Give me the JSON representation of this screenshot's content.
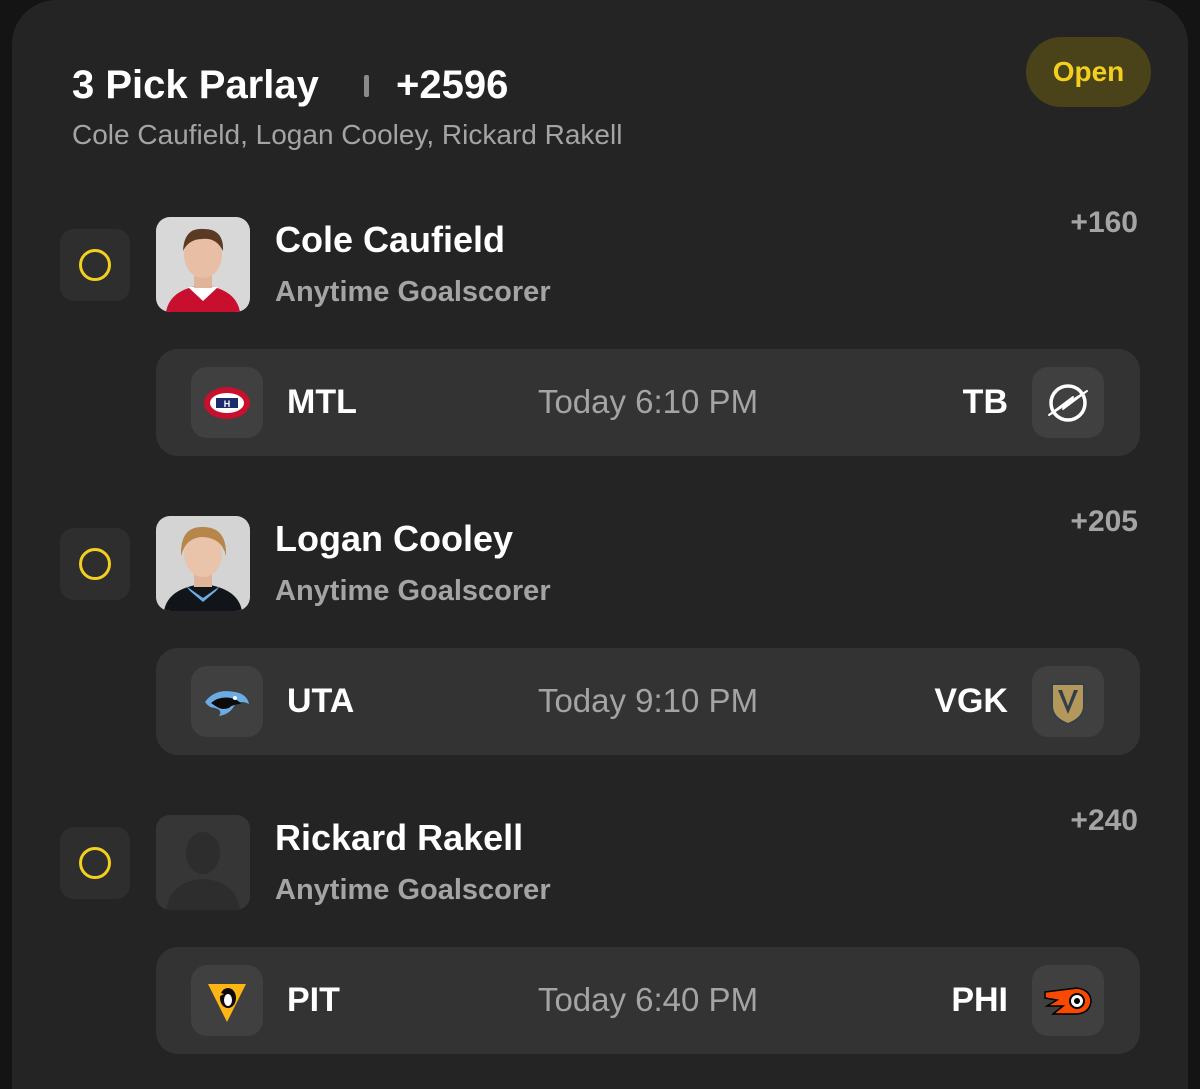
{
  "parlay": {
    "title": "3 Pick Parlay",
    "odds": "+2596",
    "players_summary": "Cole Caufield, Logan Cooley, Rickard Rakell",
    "status": "Open"
  },
  "picks": [
    {
      "player": "Cole Caufield",
      "market": "Anytime Goalscorer",
      "odds": "+160",
      "avatar": "player-photo",
      "game": {
        "home_team": "MTL",
        "home_logo": "habs-logo-icon",
        "time": "Today 6:10 PM",
        "away_team": "TB",
        "away_logo": "lightning-logo-icon"
      }
    },
    {
      "player": "Logan Cooley",
      "market": "Anytime Goalscorer",
      "odds": "+205",
      "avatar": "player-photo",
      "game": {
        "home_team": "UTA",
        "home_logo": "utah-logo-icon",
        "time": "Today 9:10 PM",
        "away_team": "VGK",
        "away_logo": "golden-knights-logo-icon"
      }
    },
    {
      "player": "Rickard Rakell",
      "market": "Anytime Goalscorer",
      "odds": "+240",
      "avatar": "placeholder-silhouette",
      "game": {
        "home_team": "PIT",
        "home_logo": "penguins-logo-icon",
        "time": "Today 6:40 PM",
        "away_team": "PHI",
        "away_logo": "flyers-logo-icon"
      }
    }
  ],
  "colors": {
    "accent_yellow": "#f3cf1f",
    "card_bg": "#242424",
    "game_bg": "#333333",
    "muted_text": "#a4a4a4"
  }
}
